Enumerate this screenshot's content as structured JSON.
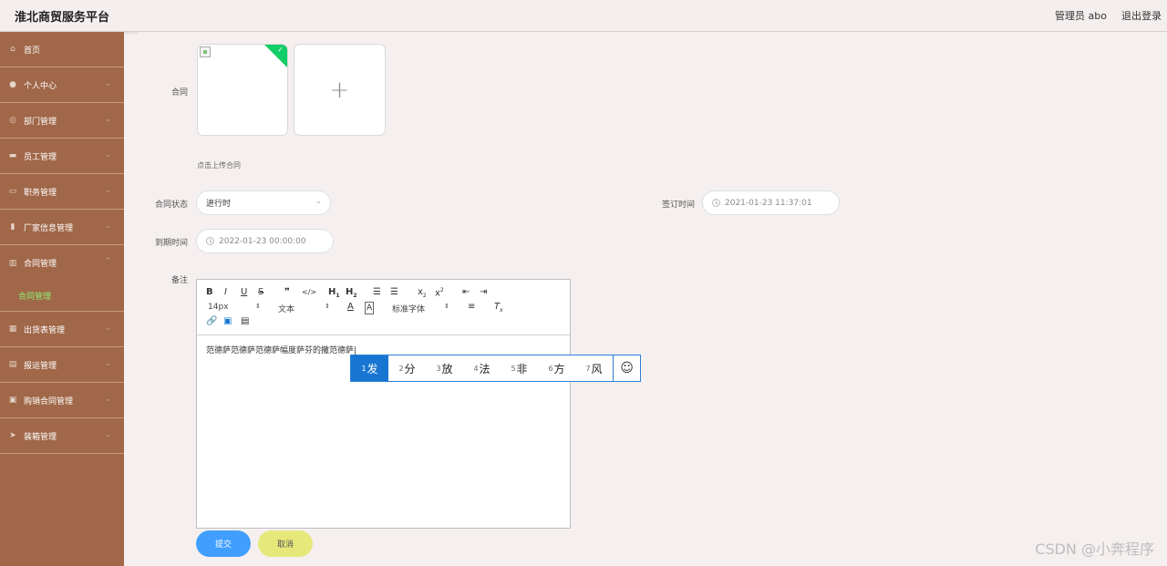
{
  "app": {
    "title": "淮北商贸服务平台",
    "user_label": "管理员 abo",
    "logout_label": "退出登录"
  },
  "sidebar": {
    "items": [
      {
        "label": "首页",
        "icon": "home-icon",
        "has_children": false
      },
      {
        "label": "个人中心",
        "icon": "user-icon",
        "has_children": true
      },
      {
        "label": "部门管理",
        "icon": "circle-icon",
        "has_children": true
      },
      {
        "label": "员工管理",
        "icon": "briefcase-icon",
        "has_children": true
      },
      {
        "label": "职务管理",
        "icon": "card-icon",
        "has_children": true
      },
      {
        "label": "厂家信息管理",
        "icon": "clipboard-icon",
        "has_children": true
      },
      {
        "label": "合同管理",
        "icon": "chart-icon",
        "has_children": true,
        "expanded": true,
        "sub": "合同管理"
      },
      {
        "label": "出货表管理",
        "icon": "grid-icon",
        "has_children": true
      },
      {
        "label": "报运管理",
        "icon": "table-icon",
        "has_children": true
      },
      {
        "label": "购销合同管理",
        "icon": "doc-icon",
        "has_children": true
      },
      {
        "label": "装箱管理",
        "icon": "send-icon",
        "has_children": true
      }
    ],
    "active_color": "#8cf274"
  },
  "form": {
    "contract_label": "合同",
    "upload_tip": "点击上传合同",
    "status_label": "合同状态",
    "status_value": "进行时",
    "sign_label": "签订时间",
    "sign_value": "2021-01-23 11:37:01",
    "expire_label": "到期时间",
    "expire_value": "2022-01-23 00:00:00",
    "remark_label": "备注",
    "editor": {
      "font_size": "14px",
      "text_type": "文本",
      "font_family": "标准字体",
      "content": "范德萨范德萨范德萨幅度萨芬的撒范德萨"
    },
    "submit_label": "提交",
    "cancel_label": "取消"
  },
  "ime": {
    "candidates": [
      {
        "n": "1",
        "c": "发"
      },
      {
        "n": "2",
        "c": "分"
      },
      {
        "n": "3",
        "c": "放"
      },
      {
        "n": "4",
        "c": "法"
      },
      {
        "n": "5",
        "c": "非"
      },
      {
        "n": "6",
        "c": "方"
      },
      {
        "n": "7",
        "c": "风"
      }
    ]
  },
  "watermark": "CSDN @小奔程序",
  "colors": {
    "sidebar": "#a06748",
    "primary": "#409eff",
    "cancel": "#e6e87a",
    "success": "#13ce66"
  }
}
